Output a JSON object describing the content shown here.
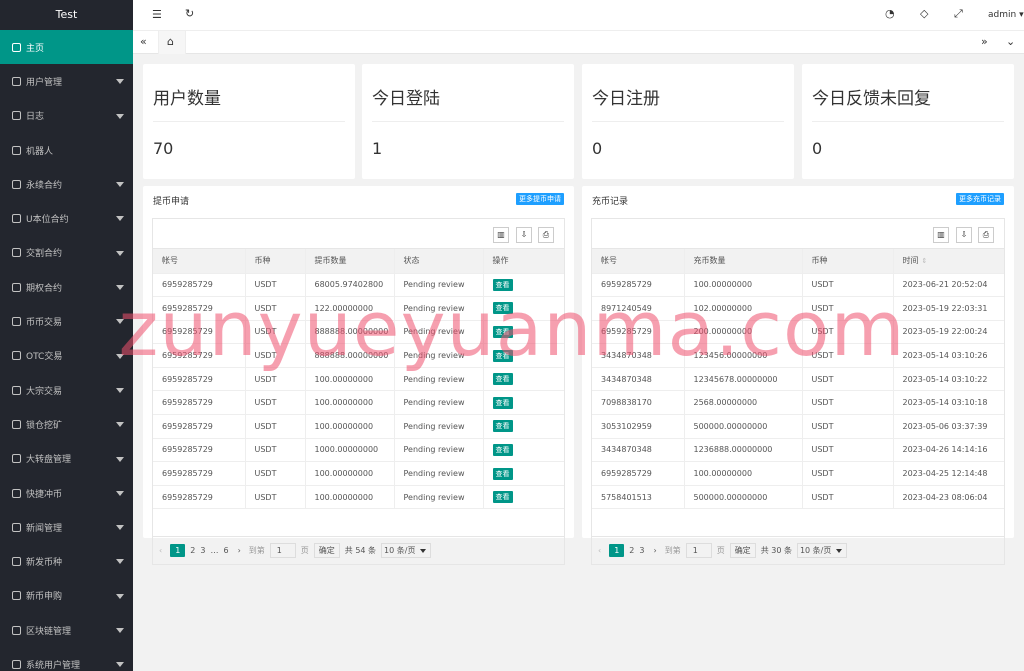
{
  "brand": "Test",
  "sidebar": {
    "items": [
      {
        "label": "主页",
        "active": true,
        "has_caret": false
      },
      {
        "label": "用户管理",
        "has_caret": true
      },
      {
        "label": "日志",
        "has_caret": true
      },
      {
        "label": "机器人",
        "has_caret": false
      },
      {
        "label": "永续合约",
        "has_caret": true
      },
      {
        "label": "U本位合约",
        "has_caret": true
      },
      {
        "label": "交割合约",
        "has_caret": true
      },
      {
        "label": "期权合约",
        "has_caret": true
      },
      {
        "label": "币币交易",
        "has_caret": true
      },
      {
        "label": "OTC交易",
        "has_caret": true
      },
      {
        "label": "大宗交易",
        "has_caret": true
      },
      {
        "label": "锁仓挖矿",
        "has_caret": true
      },
      {
        "label": "大转盘管理",
        "has_caret": true
      },
      {
        "label": "快捷冲币",
        "has_caret": true
      },
      {
        "label": "新闻管理",
        "has_caret": true
      },
      {
        "label": "新发币种",
        "has_caret": true
      },
      {
        "label": "新币申购",
        "has_caret": true
      },
      {
        "label": "区块链管理",
        "has_caret": true
      },
      {
        "label": "系统用户管理",
        "has_caret": true
      }
    ]
  },
  "topbar": {
    "user": "admin"
  },
  "stats": [
    {
      "title": "用户数量",
      "value": "70"
    },
    {
      "title": "今日登陆",
      "value": "1"
    },
    {
      "title": "今日注册",
      "value": "0"
    },
    {
      "title": "今日反馈未回复",
      "value": "0"
    }
  ],
  "withdraw": {
    "title": "提币申请",
    "more": "更多提币申请",
    "headers": [
      "帐号",
      "币种",
      "提币数量",
      "状态",
      "操作"
    ],
    "action_label": "查看",
    "rows": [
      [
        "6959285729",
        "USDT",
        "68005.97402800",
        "Pending review"
      ],
      [
        "6959285729",
        "USDT",
        "122.00000000",
        "Pending review"
      ],
      [
        "6959285729",
        "USDT",
        "888888.00000000",
        "Pending review"
      ],
      [
        "6959285729",
        "USDT",
        "888888.00000000",
        "Pending review"
      ],
      [
        "6959285729",
        "USDT",
        "100.00000000",
        "Pending review"
      ],
      [
        "6959285729",
        "USDT",
        "100.00000000",
        "Pending review"
      ],
      [
        "6959285729",
        "USDT",
        "100.00000000",
        "Pending review"
      ],
      [
        "6959285729",
        "USDT",
        "1000.00000000",
        "Pending review"
      ],
      [
        "6959285729",
        "USDT",
        "100.00000000",
        "Pending review"
      ],
      [
        "6959285729",
        "USDT",
        "100.00000000",
        "Pending review"
      ]
    ],
    "pager": {
      "pages": [
        "1",
        "2",
        "3",
        "…",
        "6"
      ],
      "goto": "到第",
      "page_input": "1",
      "page_unit": "页",
      "confirm": "确定",
      "total": "共 54 条",
      "per_page": "10 条/页"
    }
  },
  "recharge": {
    "title": "充币记录",
    "more": "更多充币记录",
    "headers": [
      "帐号",
      "充币数量",
      "币种",
      "时间"
    ],
    "rows": [
      [
        "6959285729",
        "100.00000000",
        "USDT",
        "2023-06-21 20:52:04"
      ],
      [
        "8971240549",
        "102.00000000",
        "USDT",
        "2023-05-19 22:03:31"
      ],
      [
        "6959285729",
        "200.00000000",
        "USDT",
        "2023-05-19 22:00:24"
      ],
      [
        "3434870348",
        "123456.00000000",
        "USDT",
        "2023-05-14 03:10:26"
      ],
      [
        "3434870348",
        "12345678.00000000",
        "USDT",
        "2023-05-14 03:10:22"
      ],
      [
        "7098838170",
        "2568.00000000",
        "USDT",
        "2023-05-14 03:10:18"
      ],
      [
        "3053102959",
        "500000.00000000",
        "USDT",
        "2023-05-06 03:37:39"
      ],
      [
        "3434870348",
        "1236888.00000000",
        "USDT",
        "2023-04-26 14:14:16"
      ],
      [
        "6959285729",
        "100.00000000",
        "USDT",
        "2023-04-25 12:14:48"
      ],
      [
        "5758401513",
        "500000.00000000",
        "USDT",
        "2023-04-23 08:06:04"
      ]
    ],
    "pager": {
      "pages": [
        "1",
        "2",
        "3"
      ],
      "goto": "到第",
      "page_input": "1",
      "page_unit": "页",
      "confirm": "确定",
      "total": "共 30 条",
      "per_page": "10 条/页"
    }
  },
  "watermark": "zunyueyuanma.com",
  "colors": {
    "sidebar_bg": "#23262e",
    "accent": "#009688",
    "more_btn": "#1e9fff"
  }
}
